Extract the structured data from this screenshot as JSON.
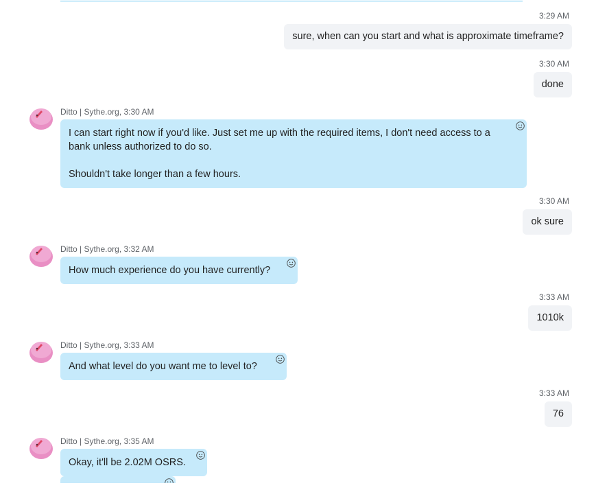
{
  "contact": {
    "name": "Ditto | Sythe.org"
  },
  "messages": [
    {
      "direction": "out",
      "time": "3:29 AM",
      "text": "sure, when can you start and what is approximate timeframe?"
    },
    {
      "direction": "out",
      "time": "3:30 AM",
      "text": "done"
    },
    {
      "direction": "in",
      "time": "3:30 AM",
      "paragraphs": [
        "I can start right now if you'd like. Just set me up with the required items, I don't need access to a bank unless authorized to do so.",
        "Shouldn't take longer than a few hours."
      ]
    },
    {
      "direction": "out",
      "time": "3:30 AM",
      "text": "ok sure"
    },
    {
      "direction": "in",
      "time": "3:32 AM",
      "text": "How much experience do you have currently?"
    },
    {
      "direction": "out",
      "time": "3:33 AM",
      "text": "1010k"
    },
    {
      "direction": "in",
      "time": "3:33 AM",
      "text": "And what level do you want me to level to?"
    },
    {
      "direction": "out",
      "time": "3:33 AM",
      "text": "76"
    },
    {
      "direction": "in",
      "time": "3:35 AM",
      "text": "Okay, it'll be 2.02M OSRS."
    }
  ],
  "colors": {
    "incoming_bubble": "#c6eafb",
    "outgoing_bubble": "#f1f3f6",
    "avatar_pink": "#e98fc4",
    "timestamp": "#5f6368"
  },
  "icons": {
    "reaction": "smiley-icon",
    "avatar": "pink-character-avatar-icon"
  }
}
